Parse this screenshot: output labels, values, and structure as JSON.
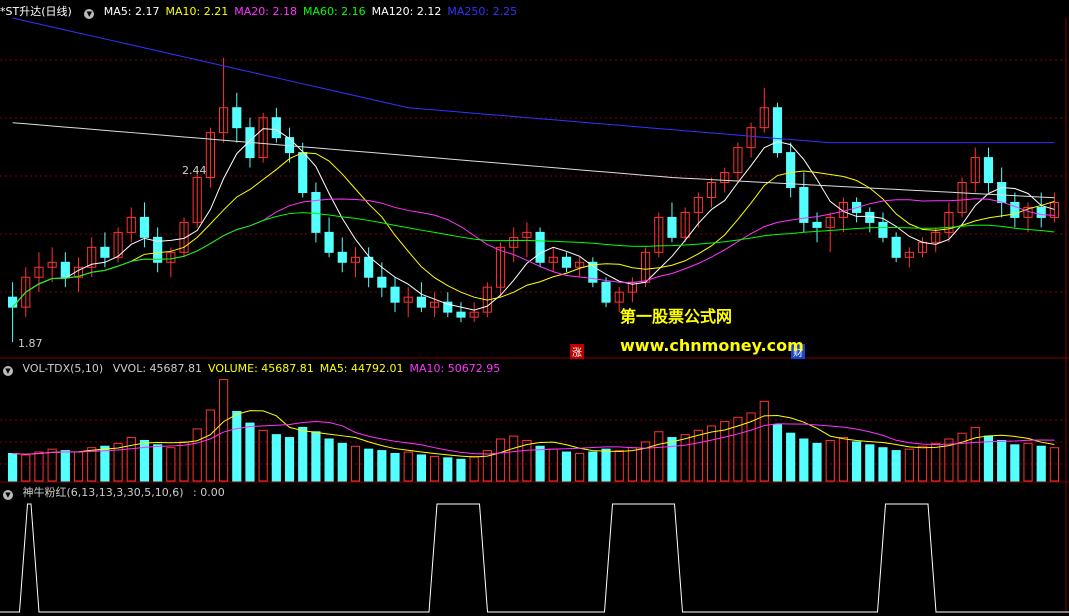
{
  "price_panel": {
    "title": "*ST升达(日线)",
    "legend": [
      {
        "label": "MA5: 2.17",
        "color": "#ffffff"
      },
      {
        "label": "MA10: 2.21",
        "color": "#ffff00"
      },
      {
        "label": "MA20: 2.18",
        "color": "#ff33ff"
      },
      {
        "label": "MA60: 2.16",
        "color": "#00ff00"
      },
      {
        "label": "MA120: 2.12",
        "color": "#ffffff"
      },
      {
        "label": "MA250: 2.25",
        "color": "#3333ff"
      }
    ],
    "high_label": "2.44",
    "low_label": "1.87",
    "marker_zhang": "涨",
    "marker_cai": "财",
    "watermark_title": "第一股票公式网",
    "watermark_url": "www.chnmoney.com"
  },
  "volume_panel": {
    "title": "VOL-TDX(5,10)",
    "legend": [
      {
        "label": "VVOL: 45687.81",
        "color": "#cccccc"
      },
      {
        "label": "VOLUME: 45687.81",
        "color": "#ffff00"
      },
      {
        "label": "MA5: 44792.01",
        "color": "#ffff00"
      },
      {
        "label": "MA10: 50672.95",
        "color": "#ff33ff"
      }
    ]
  },
  "indicator_panel": {
    "title": "神牛粉红(6,13,13,3,30,5,10,6)",
    "value": ": 0.00"
  },
  "colors": {
    "up": "#ff3232",
    "down": "#54ffff",
    "ma5": "#ffffff",
    "ma10": "#ffff00",
    "ma20": "#ff33ff",
    "ma60": "#00ff00",
    "ma120": "#ffffff",
    "ma250": "#3333ff",
    "grid": "#800000"
  },
  "chart_data": {
    "type": "candlestick",
    "y_range": [
      1.84,
      2.52
    ],
    "ohlc": [
      [
        1.96,
        1.99,
        1.87,
        1.94
      ],
      [
        1.94,
        2.02,
        1.92,
        2.0
      ],
      [
        2.0,
        2.05,
        1.97,
        2.02
      ],
      [
        2.02,
        2.06,
        1.99,
        2.03
      ],
      [
        2.03,
        2.05,
        1.98,
        2.0
      ],
      [
        2.0,
        2.04,
        1.97,
        2.02
      ],
      [
        2.02,
        2.08,
        2.0,
        2.06
      ],
      [
        2.06,
        2.09,
        2.02,
        2.04
      ],
      [
        2.04,
        2.1,
        2.03,
        2.09
      ],
      [
        2.09,
        2.14,
        2.07,
        2.12
      ],
      [
        2.12,
        2.15,
        2.06,
        2.08
      ],
      [
        2.08,
        2.1,
        2.01,
        2.03
      ],
      [
        2.03,
        2.06,
        2.0,
        2.05
      ],
      [
        2.05,
        2.12,
        2.04,
        2.11
      ],
      [
        2.11,
        2.21,
        2.1,
        2.2
      ],
      [
        2.2,
        2.3,
        2.18,
        2.29
      ],
      [
        2.29,
        2.44,
        2.27,
        2.34
      ],
      [
        2.34,
        2.37,
        2.27,
        2.3
      ],
      [
        2.3,
        2.32,
        2.22,
        2.24
      ],
      [
        2.24,
        2.33,
        2.23,
        2.32
      ],
      [
        2.32,
        2.34,
        2.27,
        2.28
      ],
      [
        2.28,
        2.3,
        2.23,
        2.25
      ],
      [
        2.25,
        2.27,
        2.16,
        2.17
      ],
      [
        2.17,
        2.19,
        2.07,
        2.09
      ],
      [
        2.09,
        2.12,
        2.04,
        2.05
      ],
      [
        2.05,
        2.08,
        2.01,
        2.03
      ],
      [
        2.03,
        2.06,
        2.0,
        2.04
      ],
      [
        2.04,
        2.06,
        1.98,
        2.0
      ],
      [
        2.0,
        2.03,
        1.96,
        1.98
      ],
      [
        1.98,
        2.0,
        1.93,
        1.95
      ],
      [
        1.95,
        1.98,
        1.92,
        1.96
      ],
      [
        1.96,
        1.99,
        1.93,
        1.94
      ],
      [
        1.94,
        1.97,
        1.92,
        1.95
      ],
      [
        1.95,
        1.97,
        1.92,
        1.93
      ],
      [
        1.93,
        1.95,
        1.91,
        1.92
      ],
      [
        1.92,
        1.95,
        1.91,
        1.93
      ],
      [
        1.93,
        1.99,
        1.92,
        1.98
      ],
      [
        1.98,
        2.07,
        1.96,
        2.06
      ],
      [
        2.06,
        2.1,
        2.03,
        2.08
      ],
      [
        2.08,
        2.11,
        2.04,
        2.09
      ],
      [
        2.09,
        2.1,
        2.02,
        2.03
      ],
      [
        2.03,
        2.06,
        2.01,
        2.04
      ],
      [
        2.04,
        2.05,
        2.01,
        2.02
      ],
      [
        2.02,
        2.04,
        2.0,
        2.03
      ],
      [
        2.03,
        2.04,
        1.98,
        1.99
      ],
      [
        1.99,
        2.0,
        1.94,
        1.95
      ],
      [
        1.95,
        1.98,
        1.93,
        1.97
      ],
      [
        1.97,
        2.0,
        1.95,
        1.99
      ],
      [
        1.99,
        2.06,
        1.98,
        2.05
      ],
      [
        2.05,
        2.13,
        2.04,
        2.12
      ],
      [
        2.12,
        2.15,
        2.07,
        2.08
      ],
      [
        2.08,
        2.14,
        2.07,
        2.13
      ],
      [
        2.13,
        2.17,
        2.1,
        2.16
      ],
      [
        2.16,
        2.2,
        2.14,
        2.19
      ],
      [
        2.19,
        2.22,
        2.17,
        2.21
      ],
      [
        2.21,
        2.27,
        2.19,
        2.26
      ],
      [
        2.26,
        2.31,
        2.24,
        2.3
      ],
      [
        2.3,
        2.38,
        2.29,
        2.34
      ],
      [
        2.34,
        2.35,
        2.24,
        2.25
      ],
      [
        2.25,
        2.27,
        2.16,
        2.18
      ],
      [
        2.18,
        2.21,
        2.09,
        2.11
      ],
      [
        2.11,
        2.13,
        2.07,
        2.1
      ],
      [
        2.1,
        2.13,
        2.05,
        2.12
      ],
      [
        2.12,
        2.16,
        2.09,
        2.15
      ],
      [
        2.15,
        2.16,
        2.11,
        2.13
      ],
      [
        2.13,
        2.14,
        2.09,
        2.11
      ],
      [
        2.11,
        2.13,
        2.07,
        2.08
      ],
      [
        2.08,
        2.09,
        2.03,
        2.04
      ],
      [
        2.04,
        2.06,
        2.02,
        2.05
      ],
      [
        2.05,
        2.08,
        2.04,
        2.07
      ],
      [
        2.07,
        2.1,
        2.05,
        2.09
      ],
      [
        2.09,
        2.15,
        2.07,
        2.13
      ],
      [
        2.13,
        2.2,
        2.12,
        2.19
      ],
      [
        2.19,
        2.26,
        2.17,
        2.24
      ],
      [
        2.24,
        2.26,
        2.17,
        2.19
      ],
      [
        2.19,
        2.22,
        2.12,
        2.15
      ],
      [
        2.15,
        2.17,
        2.1,
        2.12
      ],
      [
        2.12,
        2.15,
        2.09,
        2.14
      ],
      [
        2.14,
        2.17,
        2.1,
        2.12
      ],
      [
        2.12,
        2.17,
        2.11,
        2.15
      ]
    ],
    "volume": [
      38,
      36,
      40,
      44,
      42,
      40,
      46,
      48,
      52,
      60,
      56,
      50,
      46,
      54,
      72,
      98,
      140,
      96,
      80,
      70,
      64,
      60,
      74,
      68,
      58,
      52,
      48,
      44,
      42,
      38,
      40,
      36,
      34,
      32,
      30,
      34,
      42,
      58,
      62,
      56,
      48,
      44,
      40,
      38,
      40,
      44,
      42,
      46,
      54,
      68,
      60,
      64,
      70,
      76,
      82,
      88,
      94,
      110,
      78,
      66,
      58,
      52,
      56,
      60,
      54,
      50,
      46,
      42,
      44,
      48,
      52,
      58,
      66,
      74,
      62,
      56,
      50,
      52,
      48,
      46
    ],
    "y_range_volume": [
      0,
      145
    ],
    "signal_x": [
      5,
      10,
      110,
      125,
      155,
      175,
      225,
      240
    ]
  }
}
